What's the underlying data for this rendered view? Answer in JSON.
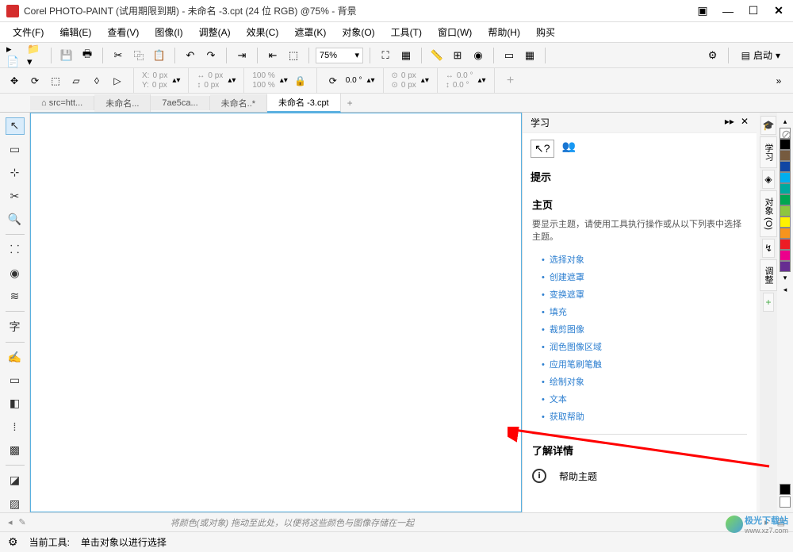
{
  "titlebar": {
    "title": "Corel PHOTO-PAINT (试用期限到期) - 未命名 -3.cpt (24 位 RGB) @75% - 背景"
  },
  "menubar": {
    "items": [
      "文件(F)",
      "编辑(E)",
      "查看(V)",
      "图像(I)",
      "调整(A)",
      "效果(C)",
      "遮罩(K)",
      "对象(O)",
      "工具(T)",
      "窗口(W)",
      "帮助(H)",
      "购买"
    ]
  },
  "toolbar1": {
    "zoom": "75%",
    "launch": "启动"
  },
  "toolbar2": {
    "x_label": "X:",
    "x_val": "0 px",
    "y_label": "Y:",
    "y_val": "0 px",
    "w_label": "↔",
    "w_val": "0 px",
    "h_label": "↕",
    "h_val": "0 px",
    "sx_val": "100 %",
    "sy_val": "100 %",
    "rot_val": "0.0 °",
    "px_val": "0 px",
    "py_val": "0 px",
    "dx_val": "0.0 °",
    "dy_val": "0.0 °"
  },
  "tabs": {
    "items": [
      "src=htt...",
      "未命名...",
      "7ae5ca...",
      "未命名..*",
      "未命名 -3.cpt"
    ]
  },
  "hints": {
    "panel_title": "学习",
    "tips_label": "提示",
    "home_title": "主页",
    "home_desc": "要显示主题，请使用工具执行操作或从以下列表中选择主题。",
    "links": [
      "选择对象",
      "创建遮罩",
      "变换遮罩",
      "填充",
      "裁剪图像",
      "润色图像区域",
      "应用笔刷笔触",
      "绘制对象",
      "文本",
      "获取帮助"
    ],
    "more_title": "了解详情",
    "help_topic": "帮助主题"
  },
  "right_tabs": {
    "items": [
      "学习",
      "对象 (O)",
      "调整"
    ]
  },
  "palette": {
    "colors": [
      "#ffffff",
      "#000000",
      "#765b3f",
      "#1146a3",
      "#00aeef",
      "#00a99d",
      "#00a651",
      "#8dc63f",
      "#fff200",
      "#f7941d",
      "#ed1c24",
      "#ec008c",
      "#662d91"
    ]
  },
  "bottom": {
    "hint": "将颜色(或对象) 拖动至此处，以便将这些颜色与图像存储在一起"
  },
  "status": {
    "tool_label": "当前工具:",
    "hint": "单击对象以进行选择"
  },
  "watermark": {
    "name": "极光下载站",
    "url": "www.xz7.com"
  }
}
